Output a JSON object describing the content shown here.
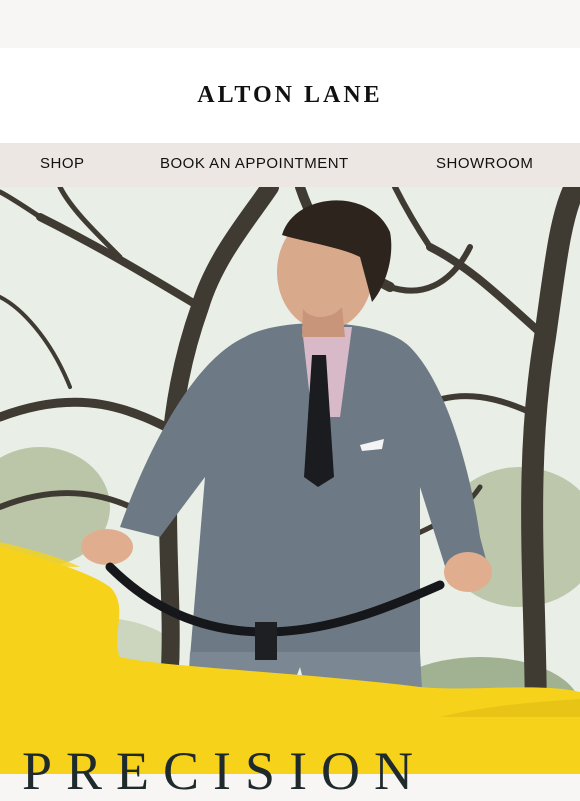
{
  "brand": {
    "name": "ALTON LANE"
  },
  "nav": {
    "items": [
      {
        "label": "SHOP"
      },
      {
        "label": "BOOK AN APPOINTMENT"
      },
      {
        "label": "SHOWROOM"
      }
    ]
  },
  "hero": {
    "headline": "PRECISION",
    "image_subject": "smiling man in grey suit riding a bicycle under trees",
    "accent_color": "#f6d21a"
  }
}
